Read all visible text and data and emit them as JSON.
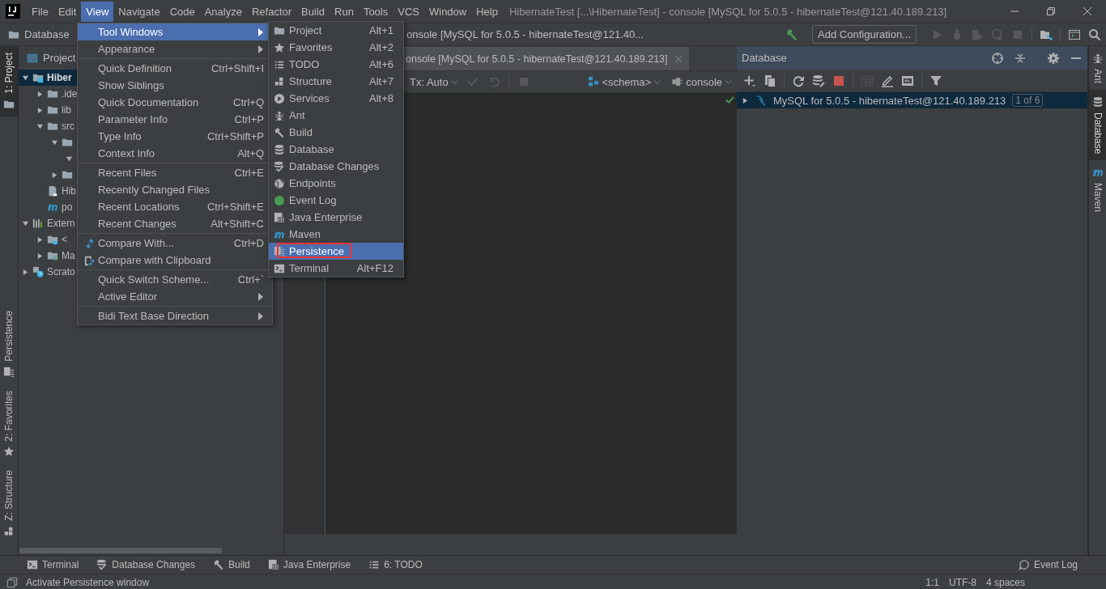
{
  "title_bar": {
    "menus": [
      {
        "label": "File",
        "selected": false
      },
      {
        "label": "Edit",
        "selected": false
      },
      {
        "label": "View",
        "selected": true
      },
      {
        "label": "Navigate",
        "selected": false
      },
      {
        "label": "Code",
        "selected": false
      },
      {
        "label": "Analyze",
        "selected": false
      },
      {
        "label": "Refactor",
        "selected": false
      },
      {
        "label": "Build",
        "selected": false
      },
      {
        "label": "Run",
        "selected": false
      },
      {
        "label": "Tools",
        "selected": false
      },
      {
        "label": "VCS",
        "selected": false
      },
      {
        "label": "Window",
        "selected": false
      },
      {
        "label": "Help",
        "selected": false
      }
    ],
    "title": "HibernateTest [...\\HibernateTest] - console [MySQL for 5.0.5 - hibernateTest@121.40.189.213]"
  },
  "nav_bar": {
    "breadcrumbs": [
      "Database",
      "onsole [MySQL for 5.0.5 - hibernateTest@121.40..."
    ],
    "run_config": "Add Configuration..."
  },
  "left_stripe": [
    {
      "label": "1: Project",
      "kind": "folder",
      "selected": true
    },
    {
      "label": "Persistence",
      "kind": "persistence",
      "selected": false
    },
    {
      "label": "2: Favorites",
      "kind": "star",
      "selected": false
    },
    {
      "label": "Z: Structure",
      "kind": "structure",
      "selected": false
    }
  ],
  "project": {
    "title": "Project",
    "tree": [
      {
        "label": "Hiber",
        "kind": "module",
        "expanded": true,
        "selected": true,
        "children": [
          {
            "label": ".ide",
            "kind": "folder",
            "expanded": false,
            "selected": false
          },
          {
            "label": "lib",
            "kind": "folder",
            "expanded": false,
            "selected": false
          },
          {
            "label": "src",
            "kind": "folder",
            "expanded": true,
            "selected": false,
            "children": [
              {
                "kind": "folder",
                "expanded": true,
                "selected": false,
                "children": [
                  {
                    "kind": "folder",
                    "expanded": true,
                    "selected": false
                  }
                ]
              },
              {
                "kind": "folder",
                "expanded": false,
                "selected": false
              }
            ]
          },
          {
            "label": "Hib",
            "kind": "file",
            "selected": false
          },
          {
            "label": "po",
            "kind": "maven",
            "selected": false
          }
        ]
      },
      {
        "label": "Extern",
        "kind": "library",
        "expanded": true,
        "selected": false,
        "children": [
          {
            "label": "<",
            "kind": "jdk",
            "expanded": false,
            "selected": false
          },
          {
            "label": "Ma",
            "kind": "library-folder",
            "expanded": false,
            "selected": false
          }
        ]
      },
      {
        "label": "Scrato",
        "kind": "scratch",
        "expanded": false,
        "selected": false
      }
    ]
  },
  "editor": {
    "tab": "onsole [MySQL for 5.0.5 - hibernateTest@121.40.189.213]",
    "tx": "Tx: Auto",
    "schema": "<schema>",
    "session": "console"
  },
  "database": {
    "title": "Database",
    "tree": [
      {
        "label": "MySQL for 5.0.5 - hibernateTest@121.40.189.213",
        "badge": "1 of 6",
        "expanded": false,
        "selected": true
      }
    ]
  },
  "right_stripe": [
    {
      "label": "Ant",
      "kind": "ant",
      "selected": false
    },
    {
      "label": "Database",
      "kind": "database",
      "selected": true
    },
    {
      "label": "Maven",
      "kind": "maven",
      "selected": false
    }
  ],
  "bottom_tabs": [
    {
      "label": "Terminal",
      "kind": "terminal"
    },
    {
      "label": "Database Changes",
      "kind": "db-changes"
    },
    {
      "label": "Build",
      "kind": "hammer"
    },
    {
      "label": "Java Enterprise",
      "kind": "java-ee"
    },
    {
      "label": "6: TODO",
      "kind": "list"
    }
  ],
  "event_log": "Event Log",
  "status_bar": {
    "message": "Activate Persistence window",
    "items": [
      "1:1",
      "UTF-8",
      "4 spaces"
    ]
  },
  "view_menu": {
    "items": [
      {
        "kind": "item",
        "label": "Tool Windows",
        "submenu": true,
        "selected": true
      },
      {
        "kind": "item",
        "label": "Appearance",
        "submenu": true,
        "selected": false
      },
      {
        "kind": "separator"
      },
      {
        "kind": "item",
        "label": "Quick Definition",
        "shortcut": "Ctrl+Shift+I",
        "selected": false
      },
      {
        "kind": "item",
        "label": "Show Siblings",
        "selected": false
      },
      {
        "kind": "item",
        "label": "Quick Documentation",
        "shortcut": "Ctrl+Q",
        "selected": false
      },
      {
        "kind": "item",
        "label": "Parameter Info",
        "shortcut": "Ctrl+P",
        "selected": false
      },
      {
        "kind": "item",
        "label": "Type Info",
        "shortcut": "Ctrl+Shift+P",
        "selected": false
      },
      {
        "kind": "item",
        "label": "Context Info",
        "shortcut": "Alt+Q",
        "selected": false
      },
      {
        "kind": "separator"
      },
      {
        "kind": "item",
        "label": "Recent Files",
        "shortcut": "Ctrl+E",
        "selected": false
      },
      {
        "kind": "item",
        "label": "Recently Changed Files",
        "selected": false
      },
      {
        "kind": "item",
        "label": "Recent Locations",
        "shortcut": "Ctrl+Shift+E",
        "selected": false
      },
      {
        "kind": "item",
        "label": "Recent Changes",
        "shortcut": "Alt+Shift+C",
        "selected": false
      },
      {
        "kind": "separator"
      },
      {
        "kind": "compare",
        "label": "Compare With...",
        "shortcut": "Ctrl+D",
        "selected": false
      },
      {
        "kind": "compare-clipboard",
        "label": "Compare with Clipboard",
        "selected": false
      },
      {
        "kind": "separator"
      },
      {
        "kind": "item",
        "label": "Quick Switch Scheme...",
        "shortcut": "Ctrl+`",
        "selected": false
      },
      {
        "kind": "item",
        "label": "Active Editor",
        "submenu": true,
        "selected": false
      },
      {
        "kind": "separator"
      },
      {
        "kind": "item",
        "label": "Bidi Text Base Direction",
        "submenu": true,
        "selected": false
      }
    ]
  },
  "tool_windows_menu": {
    "items": [
      {
        "label": "Project",
        "shortcut": "Alt+1",
        "kind": "folder",
        "selected": false,
        "outlined": false
      },
      {
        "label": "Favorites",
        "shortcut": "Alt+2",
        "kind": "star",
        "selected": false,
        "outlined": false
      },
      {
        "label": "TODO",
        "shortcut": "Alt+6",
        "kind": "list",
        "selected": false,
        "outlined": false
      },
      {
        "label": "Structure",
        "shortcut": "Alt+7",
        "kind": "structure",
        "selected": false,
        "outlined": false
      },
      {
        "label": "Services",
        "shortcut": "Alt+8",
        "kind": "services",
        "selected": false,
        "outlined": false
      },
      {
        "label": "Ant",
        "kind": "ant",
        "selected": false,
        "outlined": false
      },
      {
        "label": "Build",
        "kind": "hammer",
        "selected": false,
        "outlined": false
      },
      {
        "label": "Database",
        "kind": "database",
        "selected": false,
        "outlined": false
      },
      {
        "label": "Database Changes",
        "kind": "db-changes",
        "selected": false,
        "outlined": false
      },
      {
        "label": "Endpoints",
        "kind": "globe",
        "selected": false,
        "outlined": false
      },
      {
        "label": "Event Log",
        "kind": "event",
        "selected": false,
        "outlined": false
      },
      {
        "label": "Java Enterprise",
        "kind": "java-ee",
        "selected": false,
        "outlined": false
      },
      {
        "label": "Maven",
        "kind": "maven",
        "selected": false,
        "outlined": false
      },
      {
        "label": "Persistence",
        "kind": "persistence",
        "selected": true,
        "outlined": true
      },
      {
        "label": "Terminal",
        "shortcut": "Alt+F12",
        "kind": "terminal",
        "selected": false,
        "outlined": false
      }
    ]
  }
}
